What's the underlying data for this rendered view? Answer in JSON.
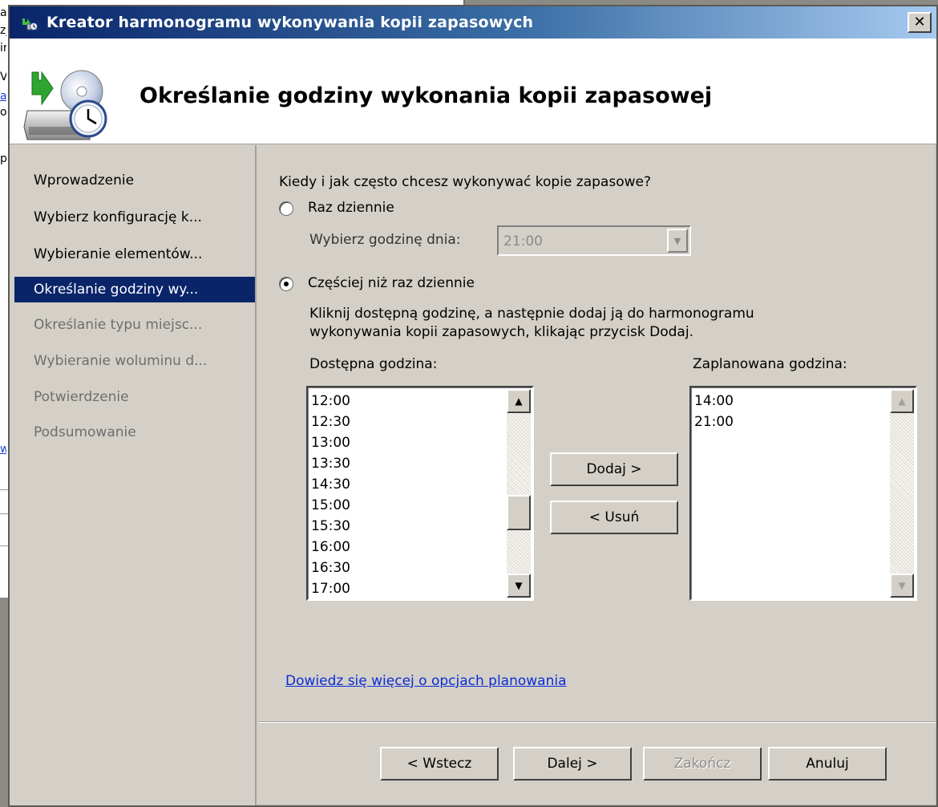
{
  "background_window": {
    "fragments": [
      "a",
      "zj",
      "ir",
      "V",
      "a",
      "oc",
      "p"
    ],
    "link_fragment": "w"
  },
  "dialog": {
    "title": "Kreator harmonogramu wykonywania kopii zapasowych",
    "close_glyph": "✕",
    "page_title": "Określanie godziny wykonania kopii zapasowej"
  },
  "sidebar": {
    "items": [
      {
        "label": "Wprowadzenie",
        "state": "normal"
      },
      {
        "label": "Wybierz konfigurację k...",
        "state": "normal"
      },
      {
        "label": "Wybieranie elementów...",
        "state": "normal"
      },
      {
        "label": "Określanie godziny wy...",
        "state": "active"
      },
      {
        "label": "Określanie typu miejsc...",
        "state": "disabled"
      },
      {
        "label": "Wybieranie woluminu d...",
        "state": "disabled"
      },
      {
        "label": "Potwierdzenie",
        "state": "disabled"
      },
      {
        "label": "Podsumowanie",
        "state": "disabled"
      }
    ]
  },
  "main": {
    "question": "Kiedy i jak często chcesz wykonywać kopie zapasowe?",
    "option_once": {
      "label": "Raz dziennie",
      "selected": false
    },
    "time_of_day_label": "Wybierz godzinę dnia:",
    "time_of_day_value": "21:00",
    "option_more": {
      "label": "Częściej niż raz dziennie",
      "selected": true
    },
    "instructions_line1": "Kliknij dostępną godzinę, a następnie dodaj ją do harmonogramu",
    "instructions_line2": "wykonywania kopii zapasowych, klikając przycisk Dodaj.",
    "available_label": "Dostępna godzina:",
    "available_times": [
      "12:00",
      "12:30",
      "13:00",
      "13:30",
      "14:30",
      "15:00",
      "15:30",
      "16:00",
      "16:30",
      "17:00"
    ],
    "scheduled_label": "Zaplanowana godzina:",
    "scheduled_times": [
      "14:00",
      "21:00"
    ],
    "add_label": "Dodaj >",
    "remove_label": "< Usuń",
    "learn_more_link": "Dowiedz się więcej o opcjach planowania"
  },
  "footer": {
    "back_label": "< Wstecz",
    "next_label": "Dalej >",
    "finish_label": "Zakończ",
    "cancel_label": "Anuluj"
  },
  "icons": {
    "app": "backup-schedule-icon",
    "header": "backup-disk-clock-icon",
    "scroll_up": "scroll-up-arrow-icon",
    "scroll_down": "scroll-down-arrow-icon",
    "combo_arrow": "chevron-down-icon"
  }
}
